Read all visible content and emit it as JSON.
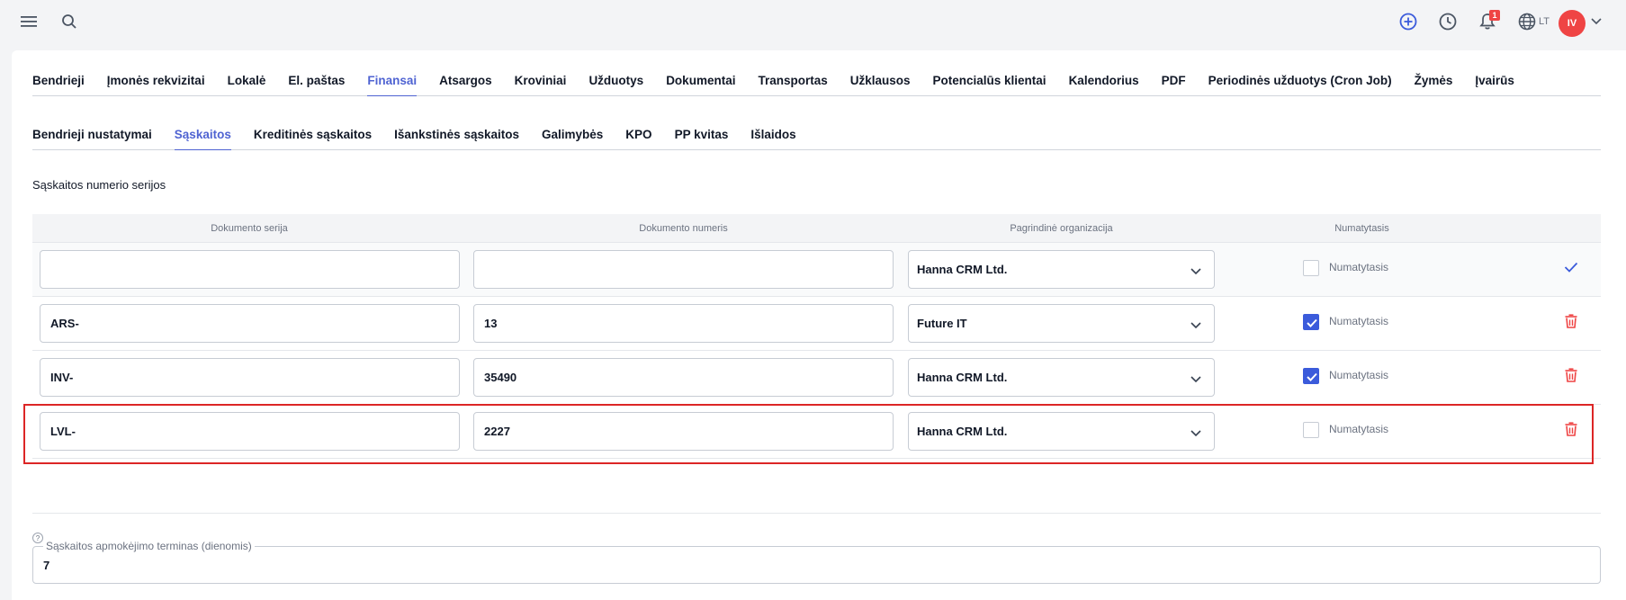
{
  "topbar": {
    "icons": [
      "menu-icon",
      "search-icon",
      "plus-circle-icon",
      "clock-icon",
      "bell-icon",
      "globe-icon",
      "chevron-down-icon"
    ],
    "notification_count": "1",
    "language": "LT",
    "avatar_initials": "IV"
  },
  "main_tabs": [
    {
      "label": "Bendrieji"
    },
    {
      "label": "Įmonės rekvizitai"
    },
    {
      "label": "Lokalė"
    },
    {
      "label": "El. paštas"
    },
    {
      "label": "Finansai"
    },
    {
      "label": "Atsargos"
    },
    {
      "label": "Kroviniai"
    },
    {
      "label": "Užduotys"
    },
    {
      "label": "Dokumentai"
    },
    {
      "label": "Transportas"
    },
    {
      "label": "Užklausos"
    },
    {
      "label": "Potencialūs klientai"
    },
    {
      "label": "Kalendorius"
    },
    {
      "label": "PDF"
    },
    {
      "label": "Periodinės užduotys (Cron Job)"
    },
    {
      "label": "Žymės"
    },
    {
      "label": "Įvairūs"
    }
  ],
  "main_active_tab": "Finansai",
  "sub_tabs": [
    {
      "label": "Bendrieji nustatymai"
    },
    {
      "label": "Sąskaitos"
    },
    {
      "label": "Kreditinės sąskaitos"
    },
    {
      "label": "Išankstinės sąskaitos"
    },
    {
      "label": "Galimybės"
    },
    {
      "label": "KPO"
    },
    {
      "label": "PP kvitas"
    },
    {
      "label": "Išlaidos"
    }
  ],
  "sub_active_tab": "Sąskaitos",
  "section_title": "Sąskaitos numerio serijos",
  "table": {
    "headers": {
      "series": "Dokumento serija",
      "number": "Dokumento numeris",
      "org": "Pagrindinė organizacija",
      "default": "Numatytasis"
    },
    "rows": [
      {
        "series": "",
        "number": "",
        "org": "Hanna CRM Ltd.",
        "default_label": "Numatytasis",
        "checked": false,
        "action": "check-icon"
      },
      {
        "series": "ARS-",
        "number": "13",
        "org": "Future IT",
        "default_label": "Numatytasis",
        "checked": true,
        "action": "trash-icon"
      },
      {
        "series": "INV-",
        "number": "35490",
        "org": "Hanna CRM Ltd.",
        "default_label": "Numatytasis",
        "checked": true,
        "action": "trash-icon"
      },
      {
        "series": "LVL-",
        "number": "2227",
        "org": "Hanna CRM Ltd.",
        "default_label": "Numatytasis",
        "checked": false,
        "action": "trash-icon"
      }
    ]
  },
  "payment_term": {
    "help_symbol": "?",
    "label": "Sąskaitos apmokėjimo terminas (dienomis)",
    "value": "7"
  },
  "colors": {
    "accent": "#4f63d2",
    "checkbox": "#3b5bdb",
    "danger": "#ef4444",
    "highlight": "#dc2626"
  }
}
